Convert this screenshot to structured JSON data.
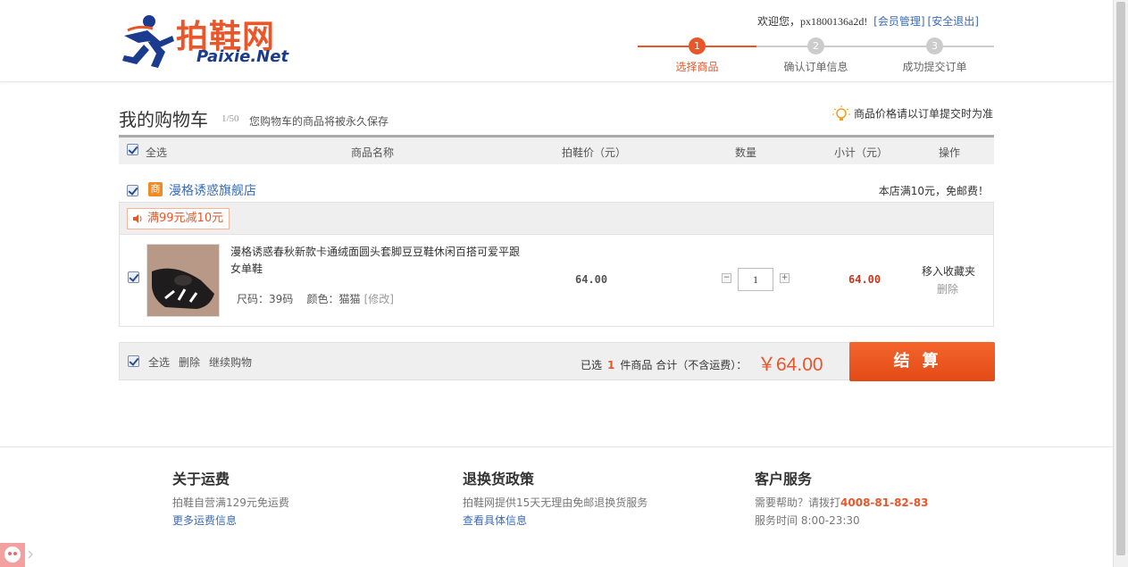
{
  "header": {
    "logo_cn": "拍鞋网",
    "logo_en": "Paixie.Net",
    "welcome": "欢迎您，",
    "username": "px1800136a2d!",
    "member_link": "[会员管理]",
    "logout_link": "[安全退出]"
  },
  "steps": [
    {
      "num": "1",
      "label": "选择商品",
      "active": true
    },
    {
      "num": "2",
      "label": "确认订单信息",
      "active": false
    },
    {
      "num": "3",
      "label": "成功提交订单",
      "active": false
    }
  ],
  "cart": {
    "title": "我的购物车",
    "count": "1/50",
    "note": "您购物车的商品将被永久保存",
    "price_tip": "商品价格请以订单提交时为准"
  },
  "table_header": {
    "select_all": "全选",
    "name": "商品名称",
    "price": "拍鞋价（元）",
    "qty": "数量",
    "subtotal": "小计（元）",
    "ops": "操作"
  },
  "shop": {
    "badge": "商",
    "name": "漫格诱惑旗舰店",
    "shipping": "本店满10元，免邮费！",
    "promo": "满99元减10元"
  },
  "item": {
    "title": "漫格诱惑春秋新款卡通绒面圆头套脚豆豆鞋休闲百搭可爱平跟女单鞋",
    "size": "尺码：39码",
    "color": "颜色：猫猫",
    "modify": "[修改]",
    "price": "64.00",
    "qty_minus": "−",
    "qty": "1",
    "qty_plus": "+",
    "subtotal": "64.00",
    "fav": "移入收藏夹",
    "delete": "删除"
  },
  "footer_bar": {
    "select_all": "全选",
    "delete": "删除",
    "continue": "继续购物",
    "selected_prefix": "已选",
    "selected_count": "1",
    "selected_suffix": "件商品  合计（不含运费）：",
    "total": "￥64.00",
    "checkout": "结算"
  },
  "site_footer": {
    "col1": {
      "title": "关于运费",
      "text": "拍鞋自营满129元免运费",
      "link": "更多运费信息"
    },
    "col2": {
      "title": "退换货政策",
      "text": "拍鞋网提供15天无理由免邮退换货服务",
      "link": "查看具体信息"
    },
    "col3": {
      "title": "客户服务",
      "text": "需要帮助？请拨打",
      "phone": "4008-81-82-83",
      "hours": "服务时间  8:00-23:30"
    }
  },
  "colors": {
    "accent": "#e8562a",
    "link": "#3a6cb5",
    "price": "#c9361c"
  }
}
